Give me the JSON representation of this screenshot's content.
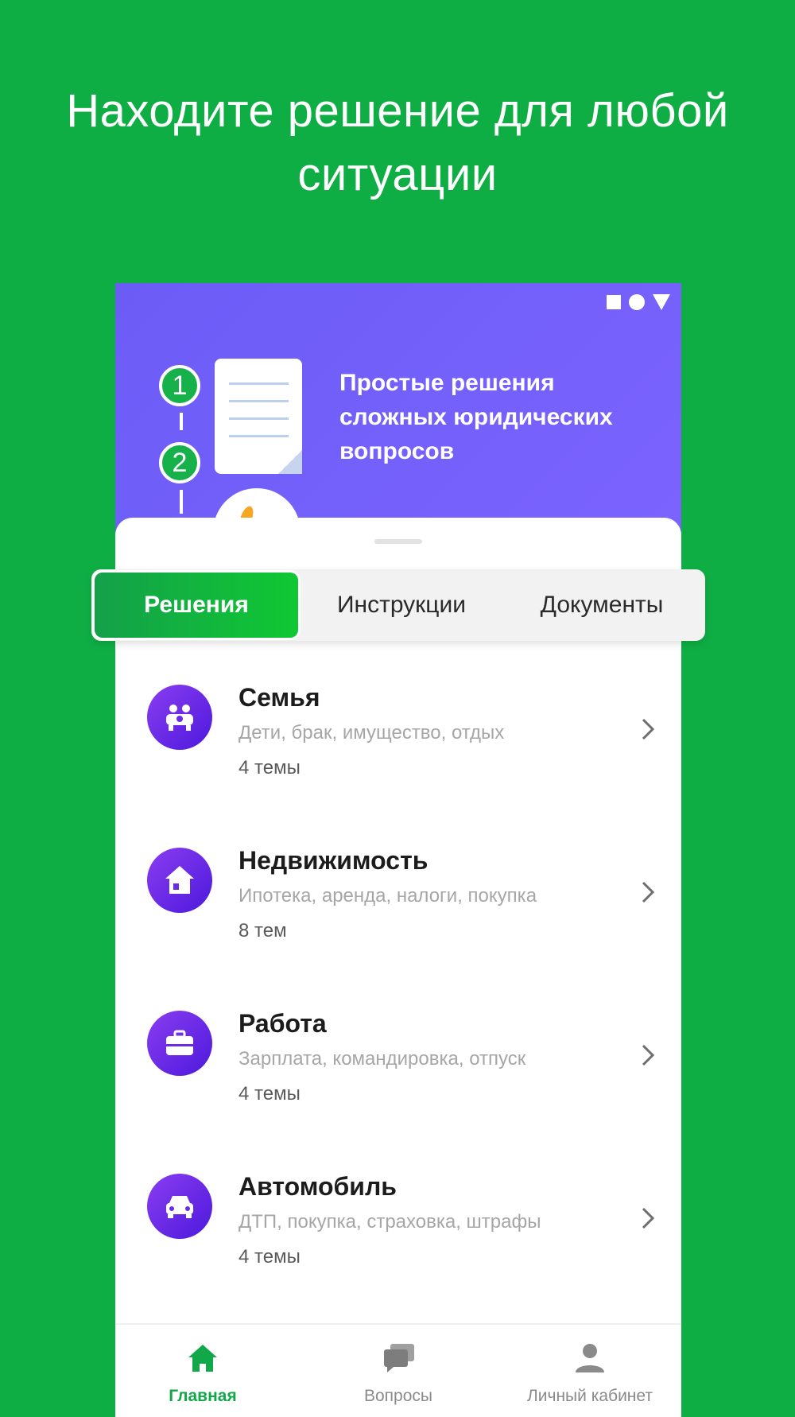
{
  "promo": {
    "headline_line1": "Находите решение для любой",
    "headline_line2": "ситуации"
  },
  "banner": {
    "steps": [
      "1",
      "2"
    ],
    "text_line1": "Простые решения",
    "text_line2": "сложных юридических",
    "text_line3": "вопросов"
  },
  "tabs": [
    {
      "label": "Решения",
      "active": true
    },
    {
      "label": "Инструкции",
      "active": false
    },
    {
      "label": "Документы",
      "active": false
    }
  ],
  "categories": [
    {
      "title": "Семья",
      "subtitle": "Дети, брак, имущество, отдых",
      "count": "4 темы",
      "icon": "family-icon"
    },
    {
      "title": "Недвижимость",
      "subtitle": "Ипотека, аренда, налоги, покупка",
      "count": "8 тем",
      "icon": "house-icon"
    },
    {
      "title": "Работа",
      "subtitle": "Зарплата, командировка, отпуск",
      "count": "4 темы",
      "icon": "briefcase-icon"
    },
    {
      "title": "Автомобиль",
      "subtitle": "ДТП, покупка, страховка, штрафы",
      "count": "4 темы",
      "icon": "car-icon"
    }
  ],
  "nav": [
    {
      "label": "Главная",
      "active": true,
      "icon": "home-icon"
    },
    {
      "label": "Вопросы",
      "active": false,
      "icon": "chat-icon"
    },
    {
      "label": "Личный кабинет",
      "active": false,
      "icon": "profile-icon"
    }
  ],
  "colors": {
    "background": "#0fae45",
    "banner": "#7163f8",
    "accent_green": "#11a84a",
    "icon_purple": "#6a2be8"
  }
}
